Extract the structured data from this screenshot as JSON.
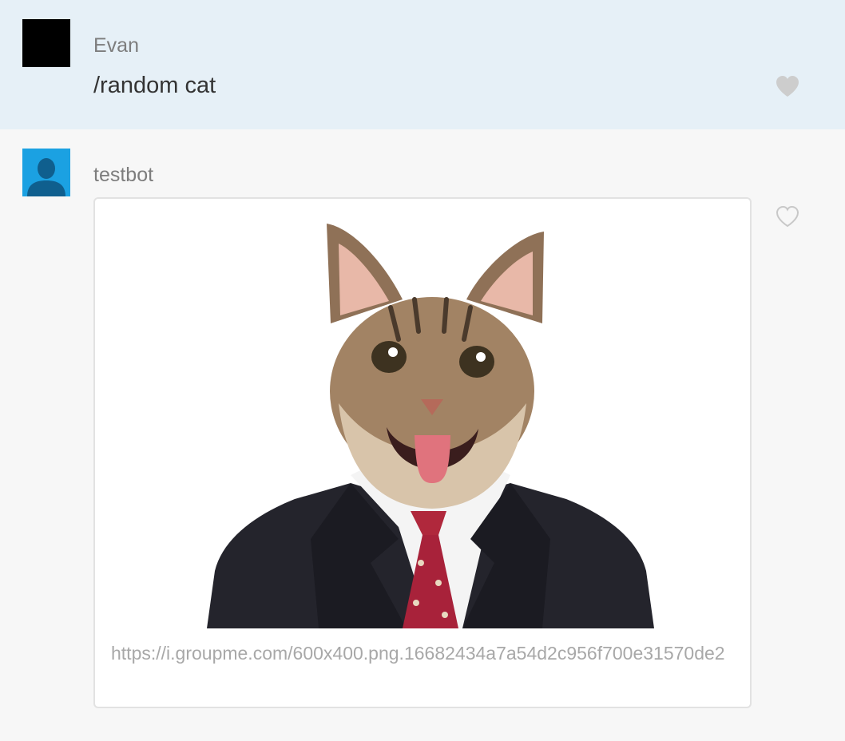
{
  "messages": [
    {
      "sender": "Evan",
      "text": "/random cat",
      "avatar": "black-square-avatar",
      "liked_icon": "heart-filled-icon"
    },
    {
      "sender": "testbot",
      "avatar": "default-person-avatar",
      "liked_icon": "heart-outline-icon",
      "attachment": {
        "image": "cat-in-suit-image",
        "url": "https://i.groupme.com/600x400.png.16682434a7a54d2c956f700e31570de2"
      }
    }
  ],
  "colors": {
    "selected_bg": "#e6f0f7",
    "bot_avatar": "#1ba1e2",
    "heart": "#c8c8c8"
  }
}
